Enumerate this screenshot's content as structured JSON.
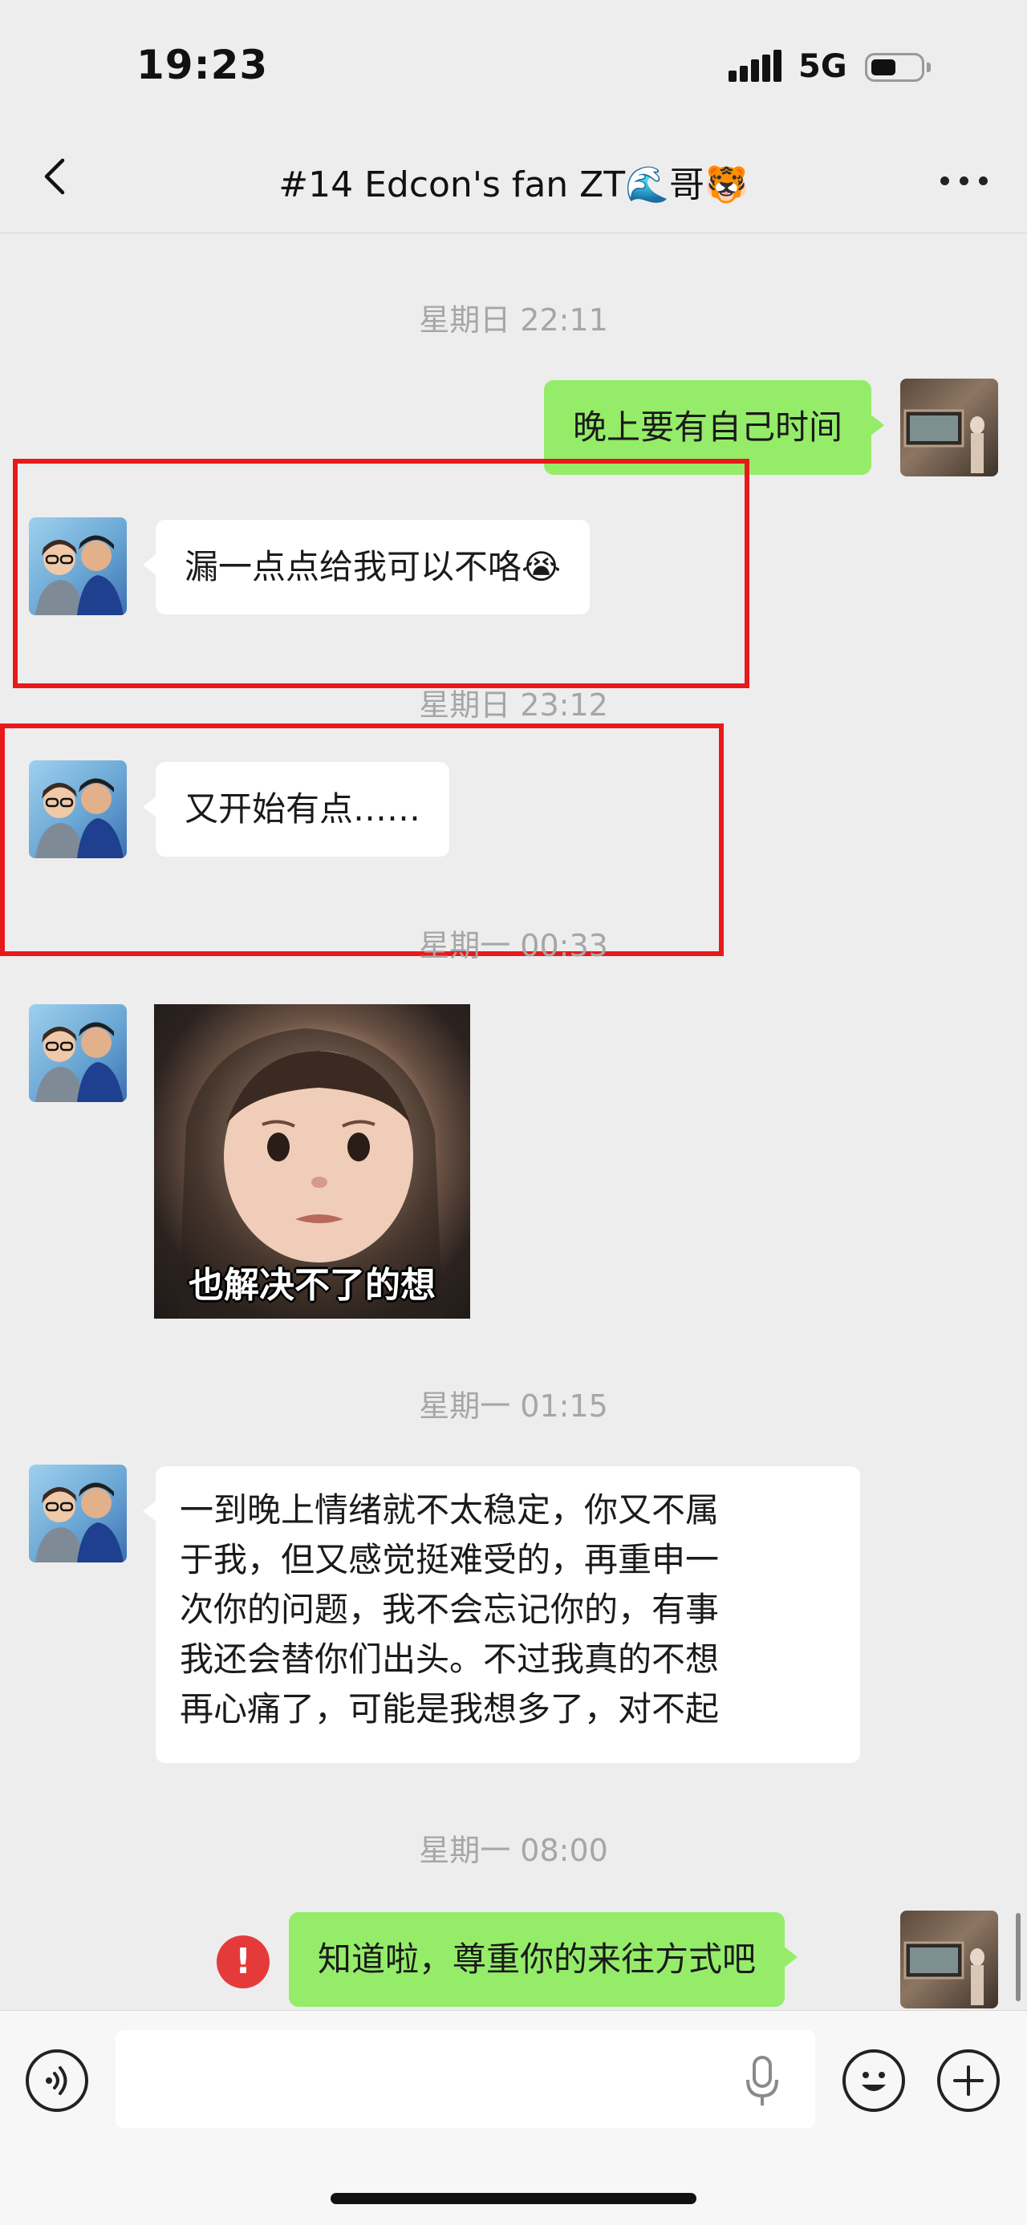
{
  "status_bar": {
    "time": "19:23",
    "network": "5G"
  },
  "nav": {
    "title": "#14 Edcon's fan ZT🌊哥🐯"
  },
  "messages": [
    {
      "type": "timestamp",
      "text": "星期日 22:11"
    },
    {
      "type": "text",
      "direction": "out",
      "text": "晚上要有自己时间"
    },
    {
      "type": "text",
      "direction": "in",
      "text": "漏一点点给我可以不咯😭"
    },
    {
      "type": "timestamp",
      "text": "星期日 23:12"
    },
    {
      "type": "text",
      "direction": "in",
      "text": "又开始有点……"
    },
    {
      "type": "timestamp",
      "text": "星期一 00:33"
    },
    {
      "type": "sticker",
      "direction": "in",
      "caption": "也解决不了的想"
    },
    {
      "type": "timestamp",
      "text": "星期一 01:15"
    },
    {
      "type": "text",
      "direction": "in",
      "lines": [
        "一到晚上情绪就不太稳定，你又不属",
        "于我，但又感觉挺难受的，再重申一",
        "次你的问题，我不会忘记你的，有事",
        "我还会替你们出头。不过我真的不想",
        "再心痛了，可能是我想多了，对不起"
      ]
    },
    {
      "type": "timestamp",
      "text": "星期一 08:00"
    },
    {
      "type": "text",
      "direction": "out",
      "status": "failed",
      "text": "知道啦，尊重你的来往方式吧"
    }
  ],
  "input_bar": {
    "placeholder": ""
  },
  "colors": {
    "incoming_bubble": "#ffffff",
    "outgoing_bubble": "#95ec69",
    "highlight": "#e8191b",
    "error": "#e53a3a"
  }
}
